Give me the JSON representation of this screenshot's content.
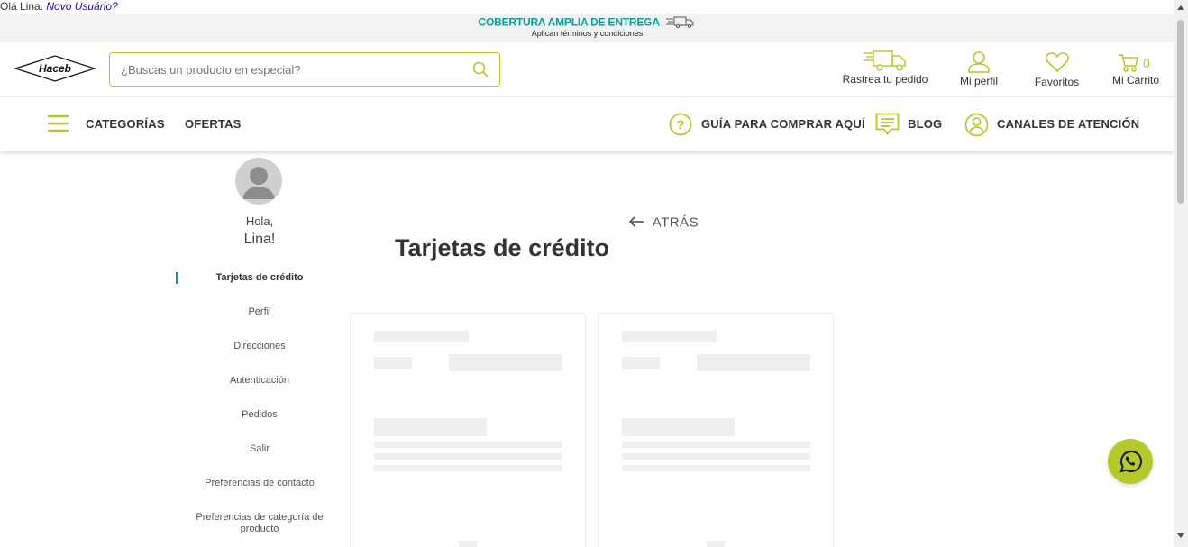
{
  "greeting": {
    "text": "Olá Lina.",
    "new_user_link": "Novo Usuário?"
  },
  "promo": {
    "title": "COBERTURA AMPLIA DE ENTREGA",
    "subtitle": "Aplican términos y condiciones"
  },
  "brand": {
    "logo_text": "Haceb",
    "accent": "#b5c92b",
    "teal": "#00a19b"
  },
  "search": {
    "placeholder": "¿Buscas un producto en especial?"
  },
  "header_actions": {
    "track": "Rastrea tu pedido",
    "profile": "Mi perfil",
    "favorites": "Favoritos",
    "cart": "Mi Carrito",
    "cart_count": "0"
  },
  "nav": {
    "categories": "CATEGORÍAS",
    "offers": "OFERTAS",
    "guide": "GUÍA PARA COMPRAR AQUÍ",
    "blog": "BLOG",
    "support": "CANALES DE ATENCIÓN"
  },
  "sidebar": {
    "hello": "Hola,",
    "name": "Lina!",
    "items": [
      {
        "label": "Tarjetas de crédito",
        "active": true
      },
      {
        "label": "Perfil"
      },
      {
        "label": "Direcciones"
      },
      {
        "label": "Autenticación"
      },
      {
        "label": "Pedidos"
      },
      {
        "label": "Salir"
      },
      {
        "label": "Preferencias de contacto"
      },
      {
        "label": "Preferencias de categoría de producto"
      }
    ]
  },
  "main": {
    "back": "ATRÁS",
    "title": "Tarjetas de crédito"
  },
  "icons": [
    "truck-icon",
    "search-icon",
    "delivery-truck-icon",
    "user-icon",
    "heart-icon",
    "cart-icon",
    "hamburger-icon",
    "question-icon",
    "blog-icon",
    "support-user-icon",
    "arrow-left-icon",
    "whatsapp-icon"
  ]
}
